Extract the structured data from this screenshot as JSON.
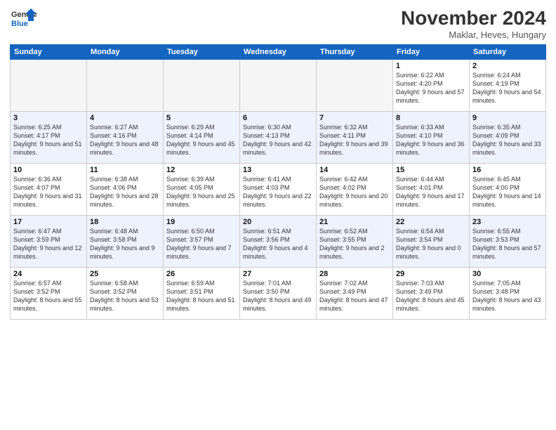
{
  "logo": {
    "line1": "General",
    "line2": "Blue"
  },
  "title": "November 2024",
  "subtitle": "Maklar, Heves, Hungary",
  "days_of_week": [
    "Sunday",
    "Monday",
    "Tuesday",
    "Wednesday",
    "Thursday",
    "Friday",
    "Saturday"
  ],
  "weeks": [
    [
      {
        "day": "",
        "info": ""
      },
      {
        "day": "",
        "info": ""
      },
      {
        "day": "",
        "info": ""
      },
      {
        "day": "",
        "info": ""
      },
      {
        "day": "",
        "info": ""
      },
      {
        "day": "1",
        "info": "Sunrise: 6:22 AM\nSunset: 4:20 PM\nDaylight: 9 hours and 57 minutes."
      },
      {
        "day": "2",
        "info": "Sunrise: 6:24 AM\nSunset: 4:19 PM\nDaylight: 9 hours and 54 minutes."
      }
    ],
    [
      {
        "day": "3",
        "info": "Sunrise: 6:25 AM\nSunset: 4:17 PM\nDaylight: 9 hours and 51 minutes."
      },
      {
        "day": "4",
        "info": "Sunrise: 6:27 AM\nSunset: 4:16 PM\nDaylight: 9 hours and 48 minutes."
      },
      {
        "day": "5",
        "info": "Sunrise: 6:29 AM\nSunset: 4:14 PM\nDaylight: 9 hours and 45 minutes."
      },
      {
        "day": "6",
        "info": "Sunrise: 6:30 AM\nSunset: 4:13 PM\nDaylight: 9 hours and 42 minutes."
      },
      {
        "day": "7",
        "info": "Sunrise: 6:32 AM\nSunset: 4:11 PM\nDaylight: 9 hours and 39 minutes."
      },
      {
        "day": "8",
        "info": "Sunrise: 6:33 AM\nSunset: 4:10 PM\nDaylight: 9 hours and 36 minutes."
      },
      {
        "day": "9",
        "info": "Sunrise: 6:35 AM\nSunset: 4:09 PM\nDaylight: 9 hours and 33 minutes."
      }
    ],
    [
      {
        "day": "10",
        "info": "Sunrise: 6:36 AM\nSunset: 4:07 PM\nDaylight: 9 hours and 31 minutes."
      },
      {
        "day": "11",
        "info": "Sunrise: 6:38 AM\nSunset: 4:06 PM\nDaylight: 9 hours and 28 minutes."
      },
      {
        "day": "12",
        "info": "Sunrise: 6:39 AM\nSunset: 4:05 PM\nDaylight: 9 hours and 25 minutes."
      },
      {
        "day": "13",
        "info": "Sunrise: 6:41 AM\nSunset: 4:03 PM\nDaylight: 9 hours and 22 minutes."
      },
      {
        "day": "14",
        "info": "Sunrise: 6:42 AM\nSunset: 4:02 PM\nDaylight: 9 hours and 20 minutes."
      },
      {
        "day": "15",
        "info": "Sunrise: 6:44 AM\nSunset: 4:01 PM\nDaylight: 9 hours and 17 minutes."
      },
      {
        "day": "16",
        "info": "Sunrise: 6:45 AM\nSunset: 4:00 PM\nDaylight: 9 hours and 14 minutes."
      }
    ],
    [
      {
        "day": "17",
        "info": "Sunrise: 6:47 AM\nSunset: 3:59 PM\nDaylight: 9 hours and 12 minutes."
      },
      {
        "day": "18",
        "info": "Sunrise: 6:48 AM\nSunset: 3:58 PM\nDaylight: 9 hours and 9 minutes."
      },
      {
        "day": "19",
        "info": "Sunrise: 6:50 AM\nSunset: 3:57 PM\nDaylight: 9 hours and 7 minutes."
      },
      {
        "day": "20",
        "info": "Sunrise: 6:51 AM\nSunset: 3:56 PM\nDaylight: 9 hours and 4 minutes."
      },
      {
        "day": "21",
        "info": "Sunrise: 6:52 AM\nSunset: 3:55 PM\nDaylight: 9 hours and 2 minutes."
      },
      {
        "day": "22",
        "info": "Sunrise: 6:54 AM\nSunset: 3:54 PM\nDaylight: 9 hours and 0 minutes."
      },
      {
        "day": "23",
        "info": "Sunrise: 6:55 AM\nSunset: 3:53 PM\nDaylight: 8 hours and 57 minutes."
      }
    ],
    [
      {
        "day": "24",
        "info": "Sunrise: 6:57 AM\nSunset: 3:52 PM\nDaylight: 8 hours and 55 minutes."
      },
      {
        "day": "25",
        "info": "Sunrise: 6:58 AM\nSunset: 3:52 PM\nDaylight: 8 hours and 53 minutes."
      },
      {
        "day": "26",
        "info": "Sunrise: 6:59 AM\nSunset: 3:51 PM\nDaylight: 8 hours and 51 minutes."
      },
      {
        "day": "27",
        "info": "Sunrise: 7:01 AM\nSunset: 3:50 PM\nDaylight: 8 hours and 49 minutes."
      },
      {
        "day": "28",
        "info": "Sunrise: 7:02 AM\nSunset: 3:49 PM\nDaylight: 8 hours and 47 minutes."
      },
      {
        "day": "29",
        "info": "Sunrise: 7:03 AM\nSunset: 3:49 PM\nDaylight: 8 hours and 45 minutes."
      },
      {
        "day": "30",
        "info": "Sunrise: 7:05 AM\nSunset: 3:48 PM\nDaylight: 8 hours and 43 minutes."
      }
    ]
  ]
}
